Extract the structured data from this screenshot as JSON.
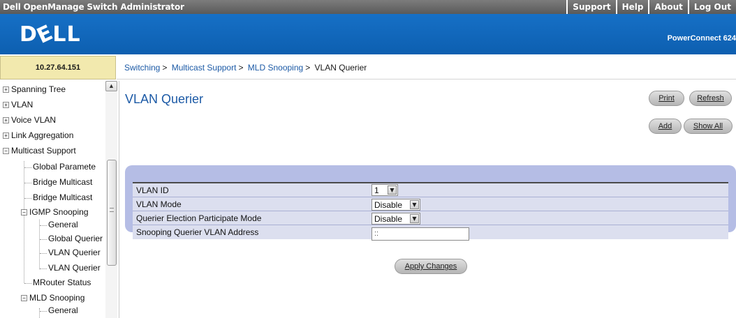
{
  "topbar": {
    "title": "Dell OpenManage Switch Administrator",
    "links": [
      "Support",
      "Help",
      "About",
      "Log Out"
    ]
  },
  "banner": {
    "logo": "DELL",
    "model": "PowerConnect 624"
  },
  "ip_address": "10.27.64.151",
  "breadcrumb": [
    "Switching",
    "Multicast Support",
    "MLD Snooping",
    "VLAN Querier"
  ],
  "sidebar": {
    "items": [
      {
        "label": "Spanning Tree",
        "expander": "+"
      },
      {
        "label": "VLAN",
        "expander": "+"
      },
      {
        "label": "Voice VLAN",
        "expander": "+"
      },
      {
        "label": "Link Aggregation",
        "expander": "+"
      },
      {
        "label": "Multicast Support",
        "expander": "−"
      },
      {
        "label": "Global Paramete"
      },
      {
        "label": "Bridge Multicast"
      },
      {
        "label": "Bridge Multicast"
      },
      {
        "label": "IGMP Snooping",
        "expander": "−"
      },
      {
        "label": "General"
      },
      {
        "label": "Global Querier"
      },
      {
        "label": "VLAN Querier"
      },
      {
        "label": "VLAN Querier"
      },
      {
        "label": "MRouter Status"
      },
      {
        "label": "MLD Snooping",
        "expander": "−"
      },
      {
        "label": "General"
      }
    ]
  },
  "main": {
    "title": "VLAN Querier",
    "buttons": {
      "print": "Print",
      "refresh": "Refresh",
      "add": "Add",
      "show_all": "Show All"
    },
    "form": {
      "vlan_id": {
        "label": "VLAN ID",
        "value": "1"
      },
      "vlan_mode": {
        "label": "VLAN Mode",
        "value": "Disable"
      },
      "querier_election": {
        "label": "Querier Election Participate Mode",
        "value": "Disable"
      },
      "snooping_address": {
        "label": "Snooping Querier VLAN Address",
        "value": "::"
      }
    },
    "apply_label": "Apply Changes"
  },
  "colors": {
    "banner": "#1670c6",
    "ip_cell": "#f2e9ae",
    "panel": "#b5bde5",
    "link": "#1c5aa6"
  },
  "icons": {
    "scroll_up": "scroll-up-arrow-icon",
    "dropdown": "chevron-down-icon",
    "expand": "plus-box-icon",
    "collapse": "minus-box-icon"
  }
}
